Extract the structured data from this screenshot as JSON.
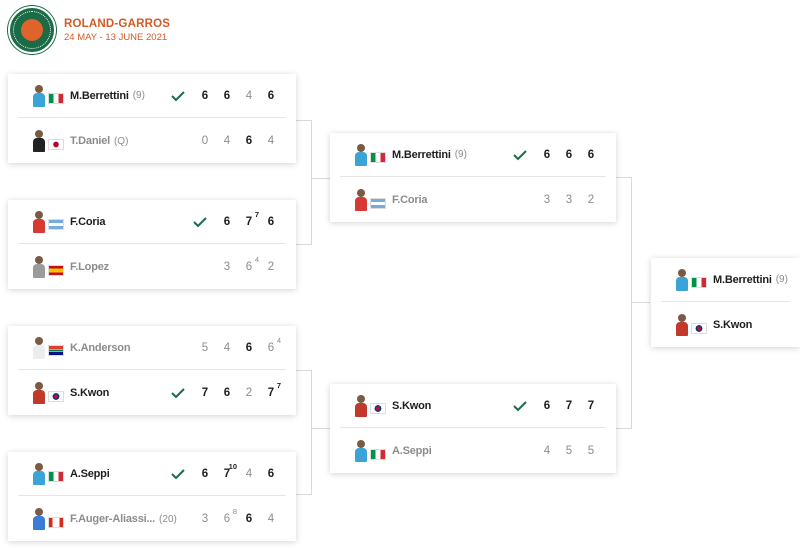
{
  "header": {
    "title": "ROLAND-GARROS",
    "dates": "24 MAY - 13 JUNE 2021"
  },
  "colors": {
    "accent": "#d35a25",
    "logo_green": "#1a6b46",
    "check": "#1a6b46"
  },
  "icons": {
    "winner": "check-icon"
  },
  "matches": [
    {
      "p1": {
        "name": "M.Berrettini",
        "seed": "(9)",
        "flag": "it",
        "winner": true,
        "scores": [
          {
            "v": "6",
            "w": true
          },
          {
            "v": "6",
            "w": true
          },
          {
            "v": "4",
            "w": false
          },
          {
            "v": "6",
            "w": true
          }
        ]
      },
      "p2": {
        "name": "T.Daniel",
        "seed": "(Q)",
        "flag": "jp",
        "winner": false,
        "scores": [
          {
            "v": "0",
            "w": false
          },
          {
            "v": "4",
            "w": false
          },
          {
            "v": "6",
            "w": true
          },
          {
            "v": "4",
            "w": false
          }
        ]
      }
    },
    {
      "p1": {
        "name": "F.Coria",
        "seed": "",
        "flag": "ar",
        "winner": true,
        "scores": [
          {
            "v": "6",
            "w": true
          },
          {
            "v": "7",
            "t": "7",
            "w": true
          },
          {
            "v": "6",
            "w": true
          }
        ]
      },
      "p2": {
        "name": "F.Lopez",
        "seed": "",
        "flag": "es",
        "winner": false,
        "scores": [
          {
            "v": "3",
            "w": false
          },
          {
            "v": "6",
            "t": "4",
            "w": false
          },
          {
            "v": "2",
            "w": false
          }
        ]
      }
    },
    {
      "p1": {
        "name": "K.Anderson",
        "seed": "",
        "flag": "za",
        "winner": false,
        "scores": [
          {
            "v": "5",
            "w": false
          },
          {
            "v": "4",
            "w": false
          },
          {
            "v": "6",
            "w": true
          },
          {
            "v": "6",
            "t": "4",
            "w": false
          }
        ]
      },
      "p2": {
        "name": "S.Kwon",
        "seed": "",
        "flag": "kr",
        "winner": true,
        "scores": [
          {
            "v": "7",
            "w": true
          },
          {
            "v": "6",
            "w": true
          },
          {
            "v": "2",
            "w": false
          },
          {
            "v": "7",
            "t": "7",
            "w": true
          }
        ]
      }
    },
    {
      "p1": {
        "name": "A.Seppi",
        "seed": "",
        "flag": "it",
        "winner": true,
        "scores": [
          {
            "v": "6",
            "w": true
          },
          {
            "v": "7",
            "t": "10",
            "w": true
          },
          {
            "v": "4",
            "w": false
          },
          {
            "v": "6",
            "w": true
          }
        ]
      },
      "p2": {
        "name": "F.Auger-Aliassi...",
        "seed": "(20)",
        "flag": "ca",
        "winner": false,
        "scores": [
          {
            "v": "3",
            "w": false
          },
          {
            "v": "6",
            "t": "8",
            "w": false
          },
          {
            "v": "6",
            "w": true
          },
          {
            "v": "4",
            "w": false
          }
        ]
      }
    },
    {
      "p1": {
        "name": "M.Berrettini",
        "seed": "(9)",
        "flag": "it",
        "winner": true,
        "scores": [
          {
            "v": "6",
            "w": true
          },
          {
            "v": "6",
            "w": true
          },
          {
            "v": "6",
            "w": true
          }
        ]
      },
      "p2": {
        "name": "F.Coria",
        "seed": "",
        "flag": "ar",
        "winner": false,
        "scores": [
          {
            "v": "3",
            "w": false
          },
          {
            "v": "3",
            "w": false
          },
          {
            "v": "2",
            "w": false
          }
        ]
      }
    },
    {
      "p1": {
        "name": "S.Kwon",
        "seed": "",
        "flag": "kr",
        "winner": true,
        "scores": [
          {
            "v": "6",
            "w": true
          },
          {
            "v": "7",
            "w": true
          },
          {
            "v": "7",
            "w": true
          }
        ]
      },
      "p2": {
        "name": "A.Seppi",
        "seed": "",
        "flag": "it",
        "winner": false,
        "scores": [
          {
            "v": "4",
            "w": false
          },
          {
            "v": "5",
            "w": false
          },
          {
            "v": "5",
            "w": false
          }
        ]
      }
    },
    {
      "p1": {
        "name": "M.Berrettini",
        "seed": "(9)",
        "flag": "it",
        "winner": false,
        "scores": []
      },
      "p2": {
        "name": "S.Kwon",
        "seed": "",
        "flag": "kr",
        "winner": false,
        "scores": []
      }
    }
  ]
}
